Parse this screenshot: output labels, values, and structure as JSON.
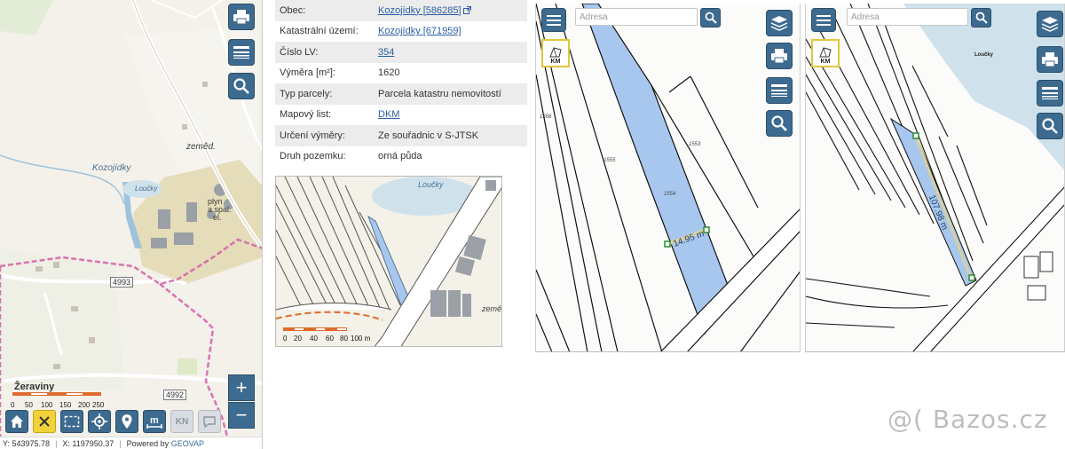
{
  "left_map": {
    "labels": {
      "village": "Kozojídky",
      "zemed": "zeměd.",
      "pond": "Loučky",
      "plyn": "plyn",
      "a_spal": "a spal.",
      "el": "el.",
      "town": "Žeraviny"
    },
    "road_numbers": [
      "4993",
      "4992"
    ],
    "scale_ticks": [
      "0",
      "50",
      "100",
      "150",
      "200",
      "250 m"
    ],
    "zoom": {
      "in": "+",
      "out": "−"
    },
    "toolbar": {
      "kn_label": "KN",
      "m_label": "m"
    },
    "status": {
      "y_coord": "Y: 543975.78",
      "x_coord": "X: 1197950.37",
      "powered_by": "Powered by",
      "vendor": "GEOVAP"
    }
  },
  "parcel_info": {
    "rows": [
      {
        "key": "Obec:",
        "value": "Kozojídky [586285]",
        "link": true,
        "ext": true
      },
      {
        "key": "Katastrální území:",
        "value": "Kozojídky [671959]",
        "link": true,
        "ext": false
      },
      {
        "key": "Číslo LV:",
        "value": "354",
        "link": true,
        "ext": false
      },
      {
        "key": "Výměra [m²]:",
        "value": "1620",
        "link": false,
        "ext": false
      },
      {
        "key": "Typ parcely:",
        "value": "Parcela katastru nemovitostí",
        "link": false,
        "ext": false
      },
      {
        "key": "Mapový list:",
        "value": "DKM",
        "link": true,
        "ext": false
      },
      {
        "key": "Určení výměry:",
        "value": "Ze souřadnic v S-JTSK",
        "link": false,
        "ext": false
      },
      {
        "key": "Druh pozemku:",
        "value": "orná půda",
        "link": false,
        "ext": false
      }
    ]
  },
  "thumbnail": {
    "pond": "Loučky",
    "zemed": "země",
    "scale_ticks": [
      "0",
      "20",
      "40",
      "60",
      "80",
      "100 m"
    ]
  },
  "cadastral_1": {
    "search_placeholder": "Adresa",
    "km_label": "KM",
    "parcels": [
      "1556",
      "1555",
      "1553",
      "1554"
    ],
    "measurement": "14.95 m"
  },
  "cadastral_2": {
    "search_placeholder": "Adresa",
    "km_label": "KM",
    "pond": "Loučky",
    "measurement": "107.98 m"
  },
  "watermark": "@( Bazos.cz",
  "colors": {
    "button_blue": "#3d6a8f",
    "parcel_fill": "#a7c7ee",
    "water": "#cfe2ec",
    "industrial": "#e5dcb9",
    "boundary_pink": "#d35ea6",
    "scale_orange": "#e06a2c",
    "link": "#2b5ea3"
  }
}
